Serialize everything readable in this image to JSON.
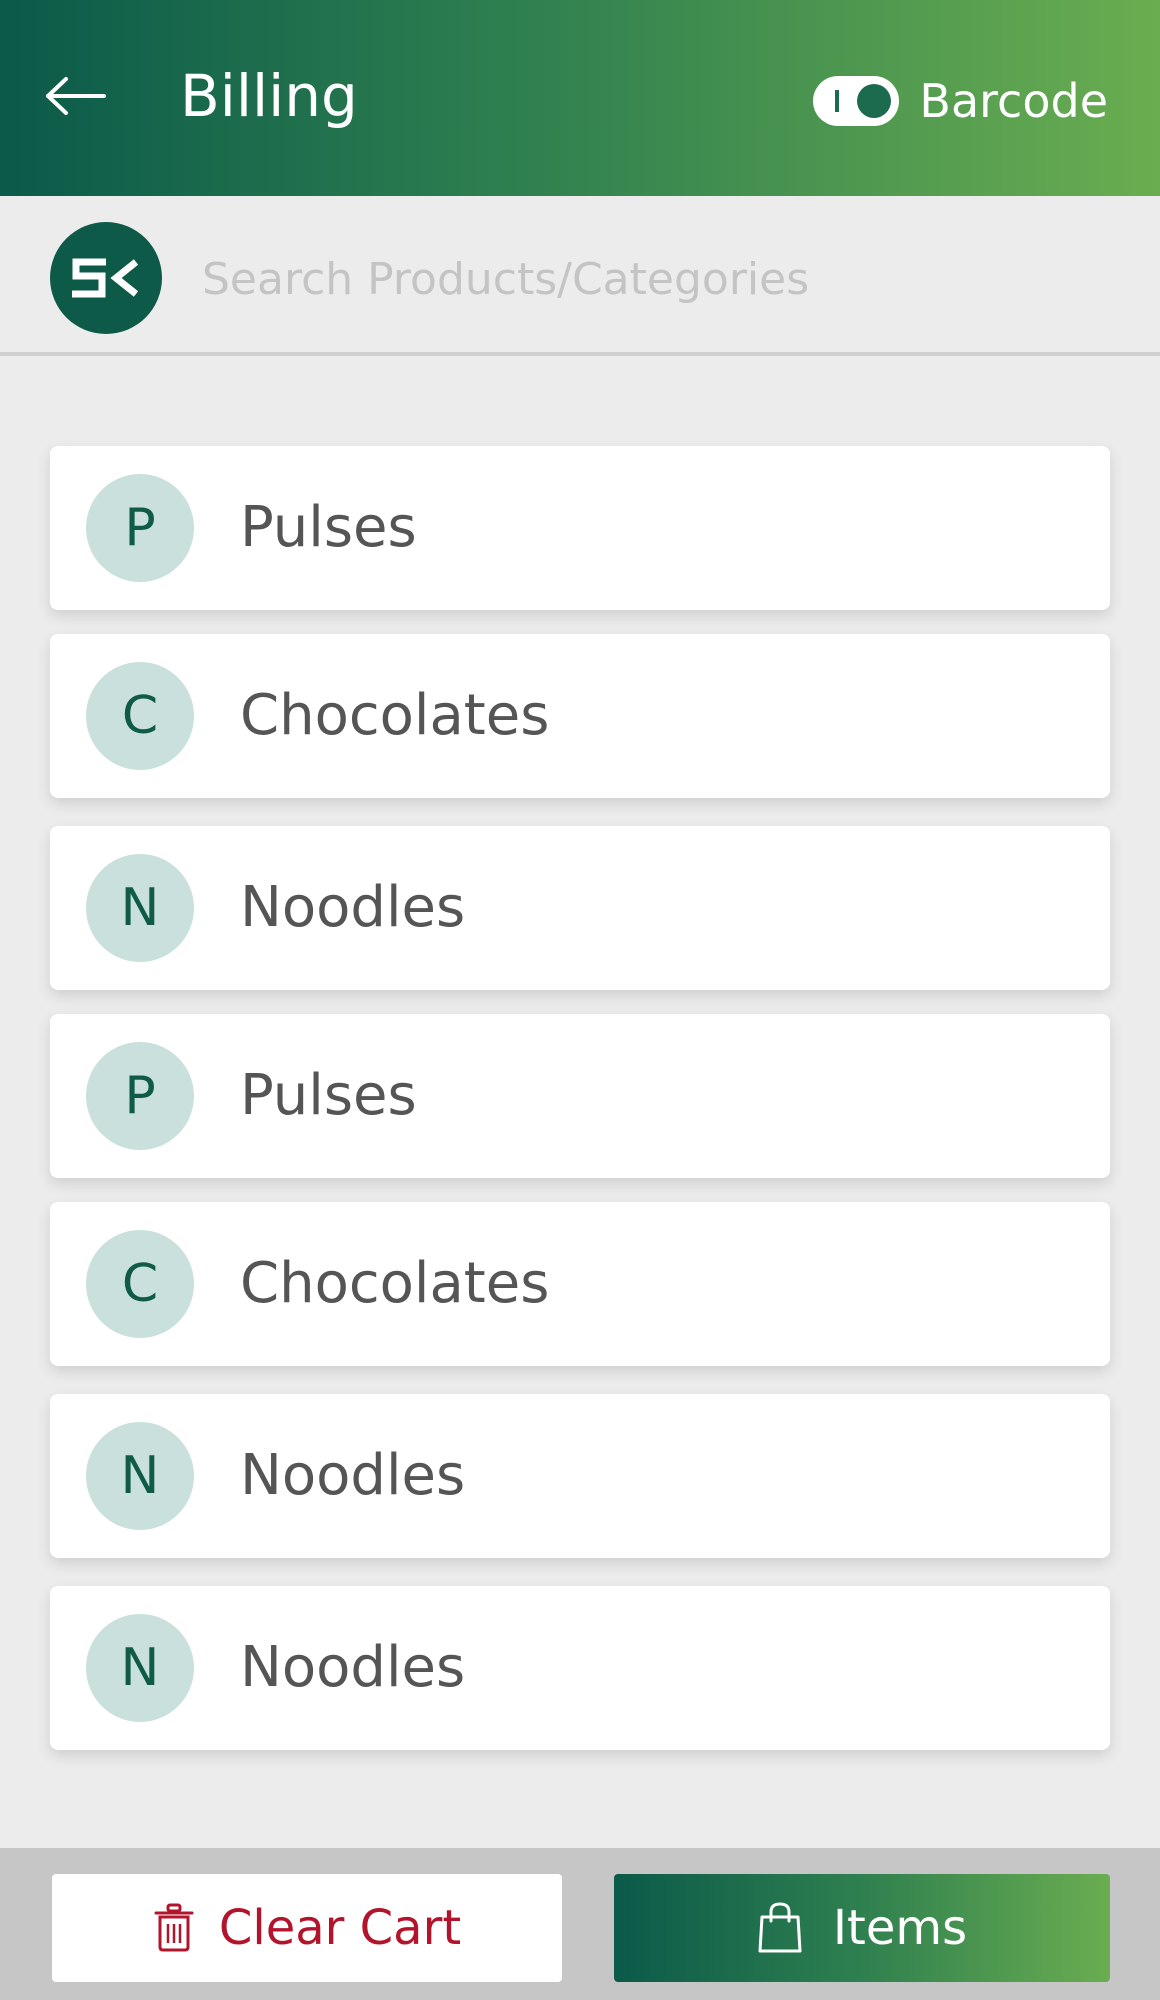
{
  "header": {
    "title": "Billing",
    "barcode_label": "Barcode",
    "barcode_toggle_on": true,
    "back_icon": "arrow-left-icon"
  },
  "search": {
    "logo_text": "SK",
    "placeholder": "Search Products/Categories"
  },
  "categories": [
    {
      "initial": "P",
      "label": "Pulses"
    },
    {
      "initial": "C",
      "label": "Chocolates"
    },
    {
      "initial": "N",
      "label": "Noodles"
    },
    {
      "initial": "P",
      "label": "Pulses"
    },
    {
      "initial": "C",
      "label": "Chocolates"
    },
    {
      "initial": "N",
      "label": "Noodles"
    },
    {
      "initial": "N",
      "label": "Noodles"
    }
  ],
  "footer": {
    "clear_cart_label": "Clear Cart",
    "clear_cart_icon": "trash-icon",
    "items_label": "Items",
    "items_icon": "shopping-bag-icon"
  },
  "colors": {
    "brand_dark": "#0b5a4a",
    "brand_light": "#6aad50",
    "avatar_bg": "#c9e0dc",
    "danger": "#b2142c"
  }
}
